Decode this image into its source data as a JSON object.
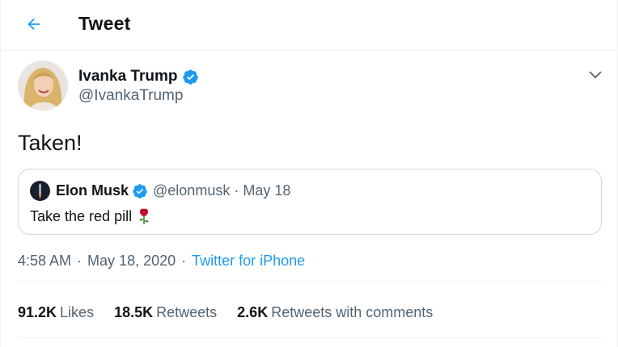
{
  "header": {
    "title": "Tweet",
    "back_icon": "arrow-left-icon"
  },
  "author": {
    "display_name": "Ivanka Trump",
    "handle": "@IvankaTrump",
    "verified": true,
    "verified_icon": "verified-badge-icon"
  },
  "tweet": {
    "text": "Taken!"
  },
  "quoted_tweet": {
    "display_name": "Elon Musk",
    "handle": "@elonmusk",
    "separator": "·",
    "date": "May 18",
    "text": "Take the red pill",
    "emoji_icon": "rose-icon"
  },
  "meta": {
    "time": "4:58 AM",
    "separator": "·",
    "date": "May 18, 2020",
    "separator2": "·",
    "source": "Twitter for iPhone"
  },
  "stats": [
    {
      "value": "91.2K",
      "label": "Likes"
    },
    {
      "value": "18.5K",
      "label": "Retweets"
    },
    {
      "value": "2.6K",
      "label": "Retweets with comments"
    }
  ],
  "colors": {
    "accent": "#1d9bf0",
    "muted": "#536471",
    "text": "#0f1419",
    "border": "#cfd9de"
  }
}
